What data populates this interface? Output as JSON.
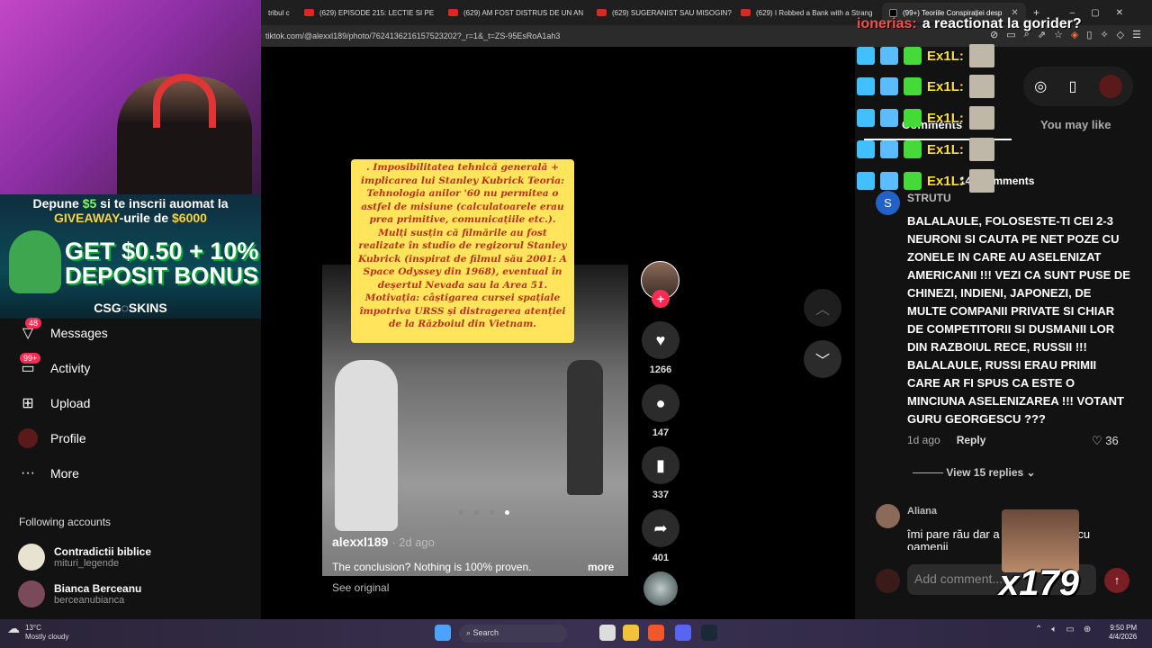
{
  "browser": {
    "tabs": [
      {
        "label": "tribul c"
      },
      {
        "label": "(629) EPISODE 215: LECTIE SI PE"
      },
      {
        "label": "(629) AM FOST DISTRUS DE UN AN"
      },
      {
        "label": "(629) SUGERANIST SAU MISOGIN?"
      },
      {
        "label": "(629) I Robbed a Bank with a Strang"
      },
      {
        "label": "(99+) Teoriile Conspirației desp"
      }
    ],
    "new_tab": "+",
    "url": "tiktok.com/@alexxl189/photo/7624136216157523202?_r=1&_t=ZS-95EsRoA1ah3"
  },
  "stream": {
    "promo_line1_a": "Depune ",
    "promo_line1_b": "$5",
    "promo_line1_c": " si te inscrii auomat la",
    "promo_line2_a": "GIVEAWAY",
    "promo_line2_b": "-urile de ",
    "promo_line2_c": "$6000",
    "promo_big1": "GET $0.50 + 10%",
    "promo_big2": "DEPOSIT BONUS",
    "promo_brand": "CSG◌SKINS",
    "chat_top_user": "ionerias:",
    "chat_top_msg": "a reactionat la gorider?",
    "chat_word": "Ex1L:",
    "combo": "x179"
  },
  "nav": {
    "messages": {
      "label": "Messages",
      "badge": "48"
    },
    "activity": {
      "label": "Activity",
      "badge": "99+"
    },
    "upload": {
      "label": "Upload"
    },
    "profile": {
      "label": "Profile"
    },
    "more": {
      "label": "More"
    },
    "following_title": "Following accounts",
    "accounts": [
      {
        "name": "Contradictii biblice",
        "handle": "mituri_legende"
      },
      {
        "name": "Bianca Berceanu",
        "handle": "berceanubianca"
      }
    ]
  },
  "post": {
    "overlay_text": ". Imposibilitatea tehnică generală + implicarea lui Stanley Kubrick Teoria: Tehnologia anilor '60 nu permitea o astfel de misiune (calculatoarele erau prea primitive, comunicațiile etc.). Mulți susțin că filmările au fost realizate în studio de regizorul Stanley Kubrick (inspirat de filmul său 2001: A Space Odyssey din 1968), eventual în deșertul Nevada sau la Area 51. Motivația: câștigarea cursei spațiale împotriva URSS și distragerea atenției de la Războiul din Vietnam.",
    "author": "alexxl189",
    "ago": "· 2d ago",
    "caption": "The conclusion? Nothing is 100% proven.",
    "more": "more",
    "see_original": "See original",
    "likes": "1266",
    "comments": "147",
    "saves": "337",
    "shares": "401"
  },
  "comments_panel": {
    "tab_comments": "Comments",
    "tab_may_like": "You may like",
    "count": "148 comments",
    "c1": {
      "avatar_letter": "S",
      "user": "STRUTU",
      "text": "BALALAULE, FOLOSESTE-TI CEI 2-3 NEURONI SI CAUTA PE NET POZE CU ZONELE IN CARE AU ASELENIZAT AMERICANII !!! VEZI CA SUNT PUSE DE CHINEZI, INDIENI, JAPONEZI, DE MULTE COMPANII PRIVATE SI CHIAR DE COMPETITORII SI DUSMANII LOR DIN RAZBOIUL RECE, RUSSII !!! BALALAULE, RUSSI ERAU PRIMII CARE AR FI SPUS CA ESTE O MINCIUNA ASELENIZAREA !!! VOTANT GURU GEORGESCU ???",
      "ago": "1d ago",
      "reply": "Reply",
      "likes": "36",
      "view_replies": "View 15 replies"
    },
    "c2": {
      "user": "Aliana",
      "text": "îmi pare rău dar a                       re nu e făcută cu oamenii"
    },
    "add_placeholder": "Add comment..."
  },
  "taskbar": {
    "temp": "13°C",
    "weather": "Mostly cloudy",
    "search": "Search",
    "time": "9:50 PM",
    "date": "4/4/2026"
  }
}
